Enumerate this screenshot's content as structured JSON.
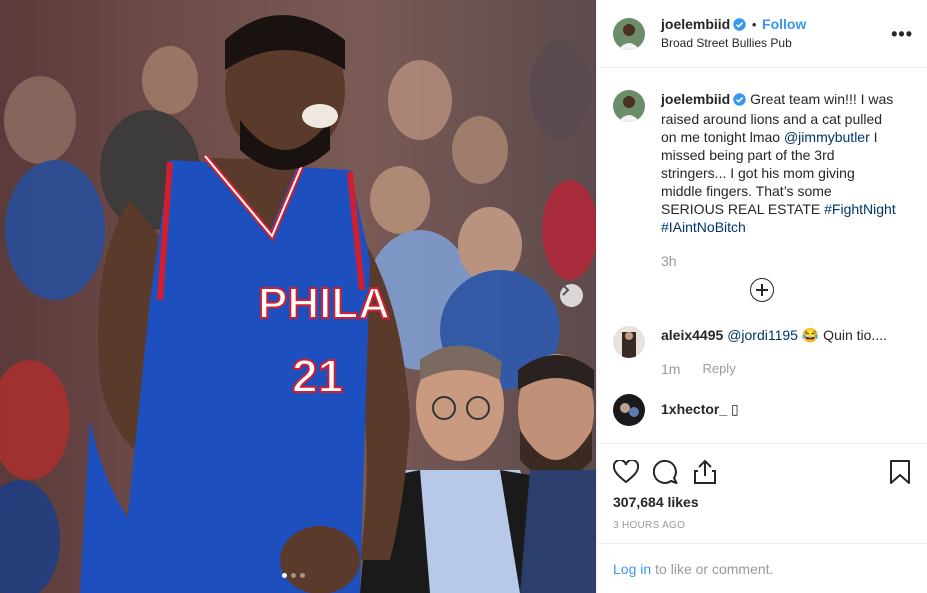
{
  "photo": {
    "jersey_text": "PHILA",
    "jersey_number": "21",
    "carousel_dots": 3,
    "active_dot": 0
  },
  "header": {
    "username": "joelembiid",
    "separator": "•",
    "follow_label": "Follow",
    "location": "Broad Street Bullies Pub",
    "more_label": "•••"
  },
  "caption": {
    "username": "joelembiid",
    "text_part1": "Great team win!!! I was raised around lions and a cat pulled on me tonight lmao ",
    "mention": "@jimmybutler",
    "text_part2": " I missed being part of the 3rd stringers... I got his mom giving middle fingers. That’s some SERIOUS REAL ESTATE ",
    "hashtag1": "#FightNight",
    "hashtag2": "#IAintNoBitch",
    "time": "3h"
  },
  "comments": [
    {
      "username": "aleix4495",
      "mention": "@jordi1195",
      "text": " 😂 Quin tio....",
      "time": "1m",
      "reply_label": "Reply"
    },
    {
      "username": "1xhector_",
      "text": " ▯"
    }
  ],
  "actions": {
    "likes": "307,684 likes",
    "time_ago": "3 HOURS AGO"
  },
  "login": {
    "link_label": "Log in",
    "rest": "to like or comment."
  },
  "colors": {
    "link_blue": "#3897f0",
    "mention_blue": "#003569",
    "jersey_blue": "#1d4fbf"
  },
  "icons": [
    "verified-badge-icon",
    "more-options-icon",
    "load-more-comments-icon",
    "heart-icon",
    "comment-icon",
    "share-icon",
    "bookmark-icon",
    "carousel-next-icon"
  ]
}
